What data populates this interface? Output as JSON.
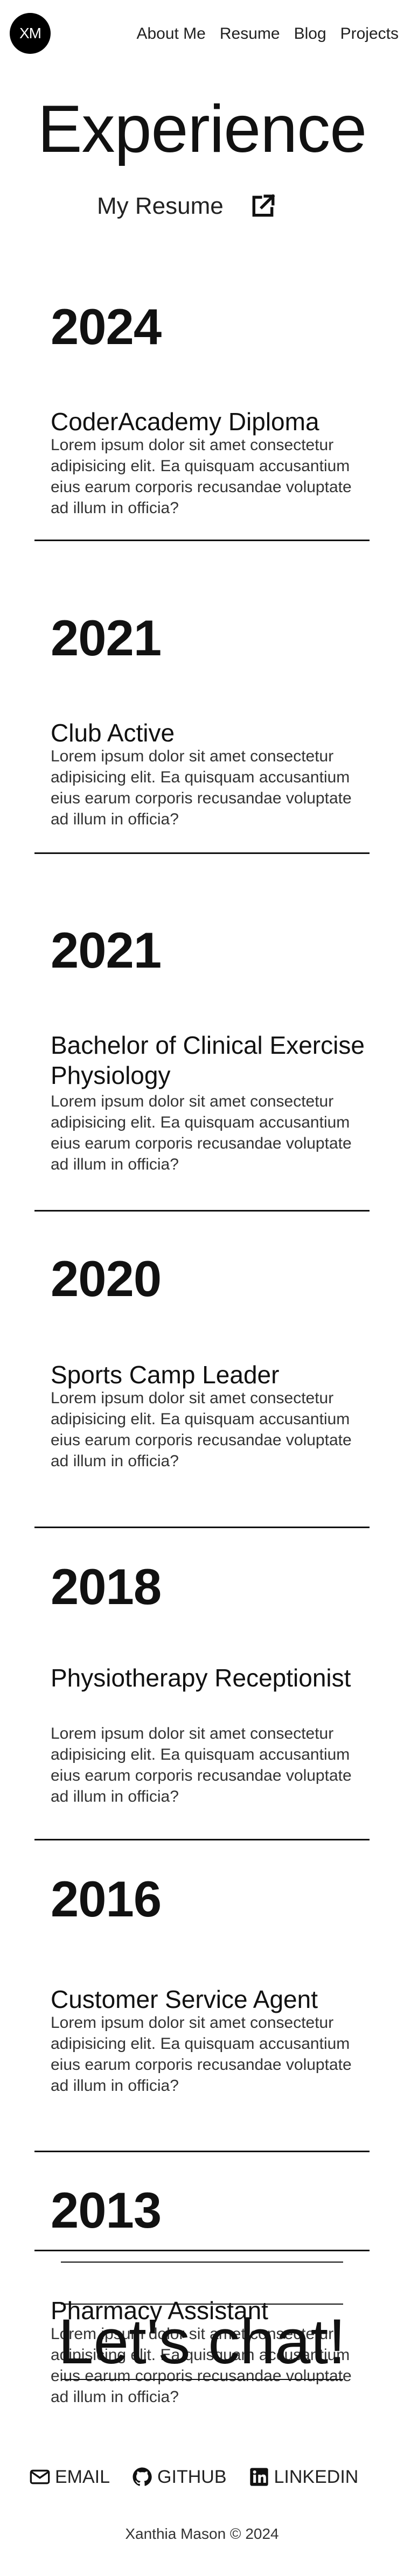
{
  "header": {
    "logo": "XM",
    "nav": [
      "About Me",
      "Resume",
      "Blog",
      "Projects"
    ]
  },
  "page_title": "Experience",
  "resume_link": "My Resume",
  "entries": [
    {
      "year": "2024",
      "role": "CoderAcademy Diploma",
      "desc": "Lorem ipsum dolor sit amet consectetur adipisicing elit. Ea quisquam accusantium eius earum corporis recusandae voluptate ad illum in officia?"
    },
    {
      "year": "2021",
      "role": "Club Active",
      "desc": "Lorem ipsum dolor sit amet consectetur adipisicing elit. Ea quisquam accusantium eius earum corporis recusandae voluptate ad illum in officia?"
    },
    {
      "year": "2021",
      "role": "Bachelor of Clinical Exercise Physiology",
      "desc": "Lorem ipsum dolor sit amet consectetur adipisicing elit. Ea quisquam accusantium eius earum corporis recusandae voluptate ad illum in officia?"
    },
    {
      "year": "2020",
      "role": "Sports Camp Leader",
      "desc": "Lorem ipsum dolor sit amet consectetur adipisicing elit. Ea quisquam accusantium eius earum corporis recusandae voluptate ad illum in officia?"
    },
    {
      "year": "2018",
      "role": "Physiotherapy Receptionist",
      "desc": "Lorem ipsum dolor sit amet consectetur adipisicing elit. Ea quisquam accusantium eius earum corporis recusandae voluptate ad illum in officia?"
    },
    {
      "year": "2016",
      "role": "Customer Service Agent",
      "desc": "Lorem ipsum dolor sit amet consectetur adipisicing elit. Ea quisquam accusantium eius earum corporis recusandae voluptate ad illum in officia?"
    },
    {
      "year": "2013",
      "role": "Pharmacy Assistant",
      "desc": "Lorem ipsum dolor sit amet consectetur adipisicing elit. Ea quisquam accusantium eius earum corporis recusandae voluptate ad illum in officia?"
    }
  ],
  "chat": "Let's chat!",
  "social": [
    {
      "icon": "mail-icon",
      "label": "EMAIL"
    },
    {
      "icon": "github-icon",
      "label": "GITHUB"
    },
    {
      "icon": "linkedin-icon",
      "label": "LINKEDIN"
    }
  ],
  "footer": "Xanthia Mason © 2024"
}
